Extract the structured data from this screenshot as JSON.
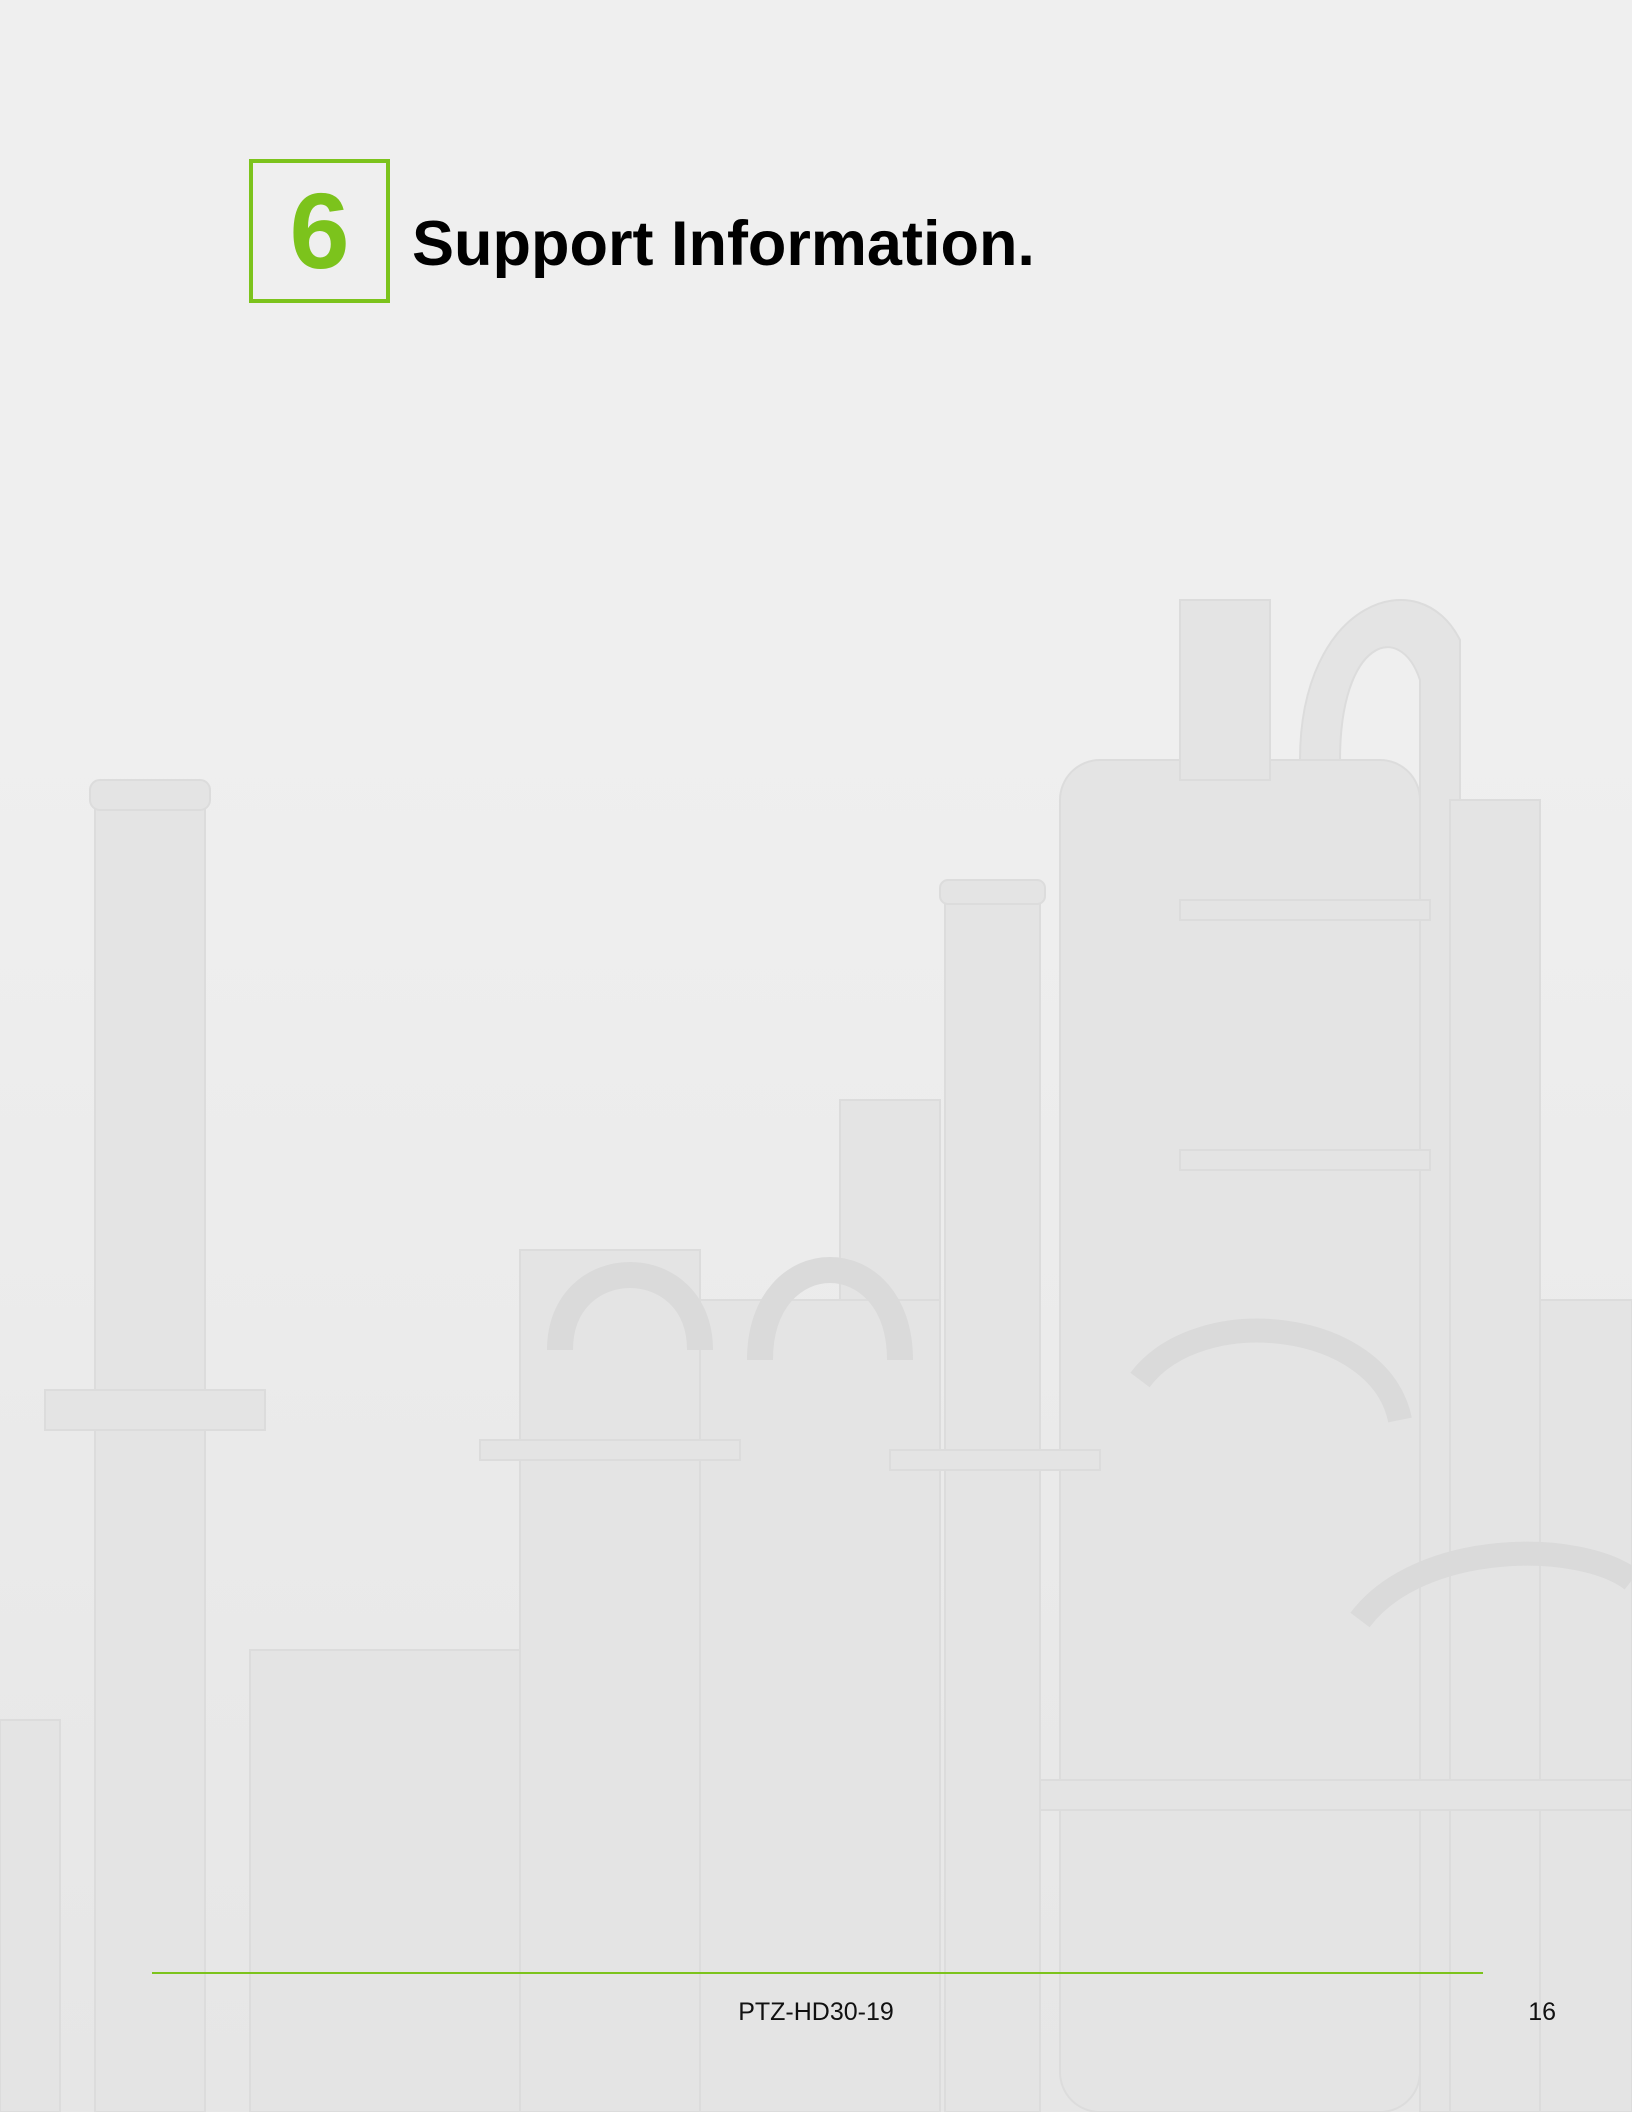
{
  "chapter": {
    "number": "6",
    "title": "Support Information."
  },
  "footer": {
    "document_code": "PTZ-HD30-19",
    "page_number": "16"
  },
  "colors": {
    "accent": "#7cc31c",
    "background": "#efefef"
  },
  "background_image": "faded-refinery-illustration"
}
